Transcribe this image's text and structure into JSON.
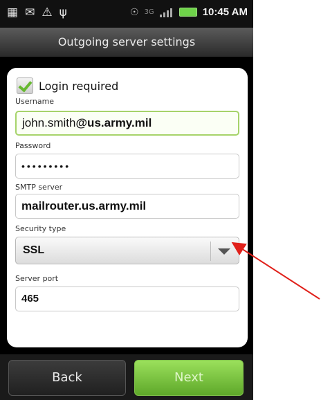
{
  "status_bar": {
    "time": "10:45 AM",
    "icons": [
      "calendar-icon",
      "mail-icon",
      "warning-icon",
      "usb-icon",
      "sound-icon",
      "3g-icon",
      "signal-icon",
      "battery-icon"
    ]
  },
  "title": "Outgoing server settings",
  "form": {
    "login_required": {
      "label": "Login required",
      "checked": true
    },
    "username": {
      "label": "Username",
      "value_user": "john.smith",
      "value_domain": "@us.army.mil"
    },
    "password": {
      "label": "Password",
      "value": "•••••••••"
    },
    "smtp_server": {
      "label": "SMTP server",
      "value": "mailrouter.us.army.mil"
    },
    "security_type": {
      "label": "Security type",
      "value": "SSL"
    },
    "server_port": {
      "label": "Server port",
      "value": "465"
    }
  },
  "buttons": {
    "back": "Back",
    "next": "Next"
  },
  "colors": {
    "accent_green": "#6cbc34",
    "annotation_arrow": "#e0201a"
  }
}
